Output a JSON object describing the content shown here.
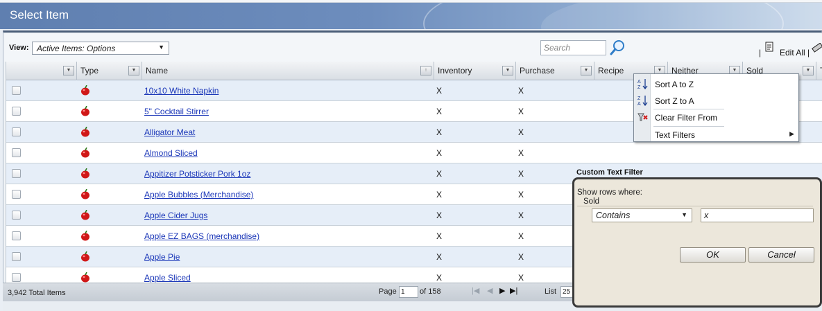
{
  "window": {
    "title": "Select Item"
  },
  "toolbar": {
    "view_label": "View:",
    "view_value": "Active Items: Options",
    "search_placeholder": "Search",
    "sep": "|",
    "edit_all": "Edit All |"
  },
  "columns": [
    "",
    "Type",
    "Name",
    "Inventory",
    "Purchase",
    "Recipe",
    "Neither",
    "Sold",
    "Ta"
  ],
  "rows": [
    {
      "name": "10x10 White Napkin",
      "inventory": "X",
      "purchase": "X"
    },
    {
      "name": "5\" Cocktail Stirrer",
      "inventory": "X",
      "purchase": "X"
    },
    {
      "name": "Alligator Meat",
      "inventory": "X",
      "purchase": "X"
    },
    {
      "name": "Almond Sliced",
      "inventory": "X",
      "purchase": "X"
    },
    {
      "name": "Appitizer Potsticker Pork 1oz",
      "inventory": "X",
      "purchase": "X"
    },
    {
      "name": "Apple Bubbles (Merchandise)",
      "inventory": "X",
      "purchase": "X"
    },
    {
      "name": "Apple Cider Jugs",
      "inventory": "X",
      "purchase": "X"
    },
    {
      "name": "Apple EZ BAGS (merchandise)",
      "inventory": "X",
      "purchase": "X"
    },
    {
      "name": "Apple Pie",
      "inventory": "X",
      "purchase": "X"
    },
    {
      "name": "Apple Sliced",
      "inventory": "X",
      "purchase": "X"
    }
  ],
  "footer": {
    "total": "3,942 Total Items",
    "page_label": "Page",
    "page_value": "1",
    "of_label": "of 158",
    "list_label": "List",
    "list_value": "25"
  },
  "context_menu": {
    "sort_az": "Sort A to Z",
    "sort_za": "Sort Z to A",
    "clear_filter": "Clear Filter From",
    "text_filters": "Text Filters"
  },
  "dialog": {
    "title": "Custom Text Filter",
    "show_rows": "Show rows where:",
    "field": "Sold",
    "operator": "Contains",
    "value": "x",
    "ok": "OK",
    "cancel": "Cancel"
  },
  "colors": {
    "accent": "#5f7fb0",
    "link": "#1a36b8",
    "row_alt": "#e6eef8"
  },
  "icons": {
    "type": "apple-icon",
    "search": "magnifier-icon"
  }
}
